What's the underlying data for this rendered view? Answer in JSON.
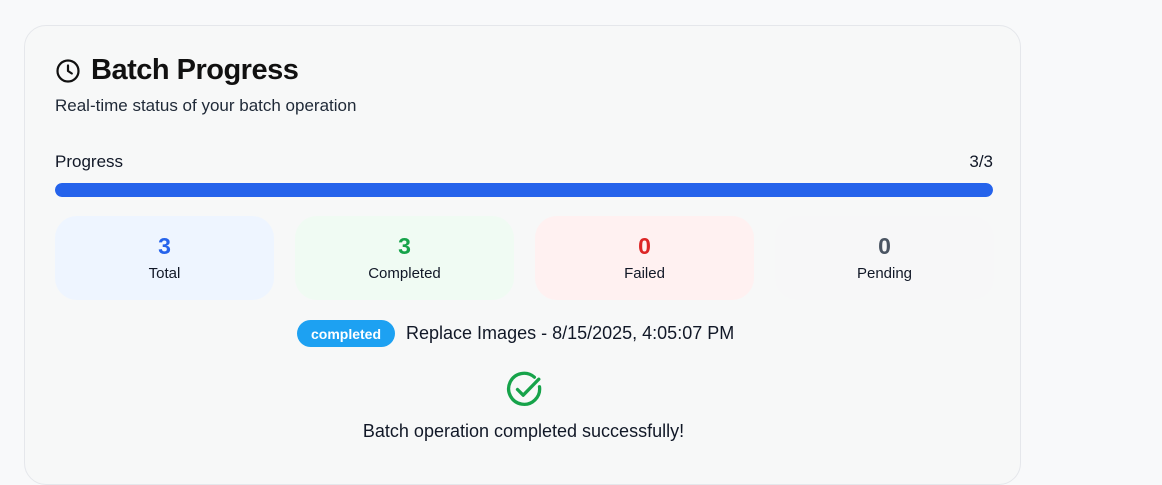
{
  "card": {
    "title": "Batch Progress",
    "subtitle": "Real-time status of your batch operation",
    "title_icon": "clock-icon"
  },
  "progress": {
    "label": "Progress",
    "text": "3/3",
    "fraction": 1,
    "fill_color": "#2563eb"
  },
  "stats": {
    "total": {
      "value": "3",
      "label": "Total",
      "color": "#2563eb"
    },
    "completed": {
      "value": "3",
      "label": "Completed",
      "color": "#16a34a"
    },
    "failed": {
      "value": "0",
      "label": "Failed",
      "color": "#dc2626"
    },
    "pending": {
      "value": "0",
      "label": "Pending",
      "color": "#4b5563"
    }
  },
  "operation": {
    "status": "completed",
    "status_color": "#1da1f2",
    "text": "Replace Images - 8/15/2025, 4:05:07 PM"
  },
  "result": {
    "icon": "check-circle-icon",
    "message": "Batch operation completed successfully!",
    "color": "#16a34a"
  }
}
